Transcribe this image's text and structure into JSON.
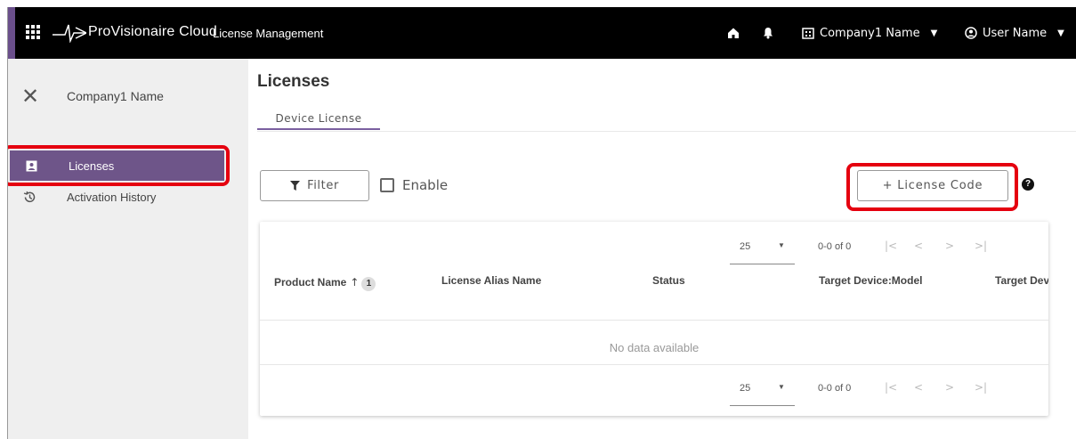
{
  "topbar": {
    "brand": "ProVisionaire Cloud",
    "app_name": "License Management",
    "company": "Company1 Name",
    "user": "User Name"
  },
  "sidebar": {
    "company": "Company1 Name",
    "items": [
      {
        "label": "Licenses",
        "icon": "badge-icon",
        "selected": true
      },
      {
        "label": "Activation History",
        "icon": "history-icon",
        "selected": false
      }
    ]
  },
  "main": {
    "title": "Licenses",
    "tabs": [
      {
        "label": "Device License",
        "active": true
      }
    ],
    "filter_label": "Filter",
    "enable_label": "Enable",
    "enable_checked": false,
    "license_code_label": "+ License Code"
  },
  "table": {
    "headers": [
      "Product Name",
      "License Alias Name",
      "Status",
      "Target Device:Model",
      "Target Devic"
    ],
    "sort_badge": "1",
    "empty_text": "No data available",
    "per_page": "25",
    "range": "0-0 of 0"
  },
  "colors": {
    "topbar": "#000000",
    "accent": "#6e5589",
    "highlight": "#e5000f",
    "sidebar_bg": "#efefef"
  }
}
